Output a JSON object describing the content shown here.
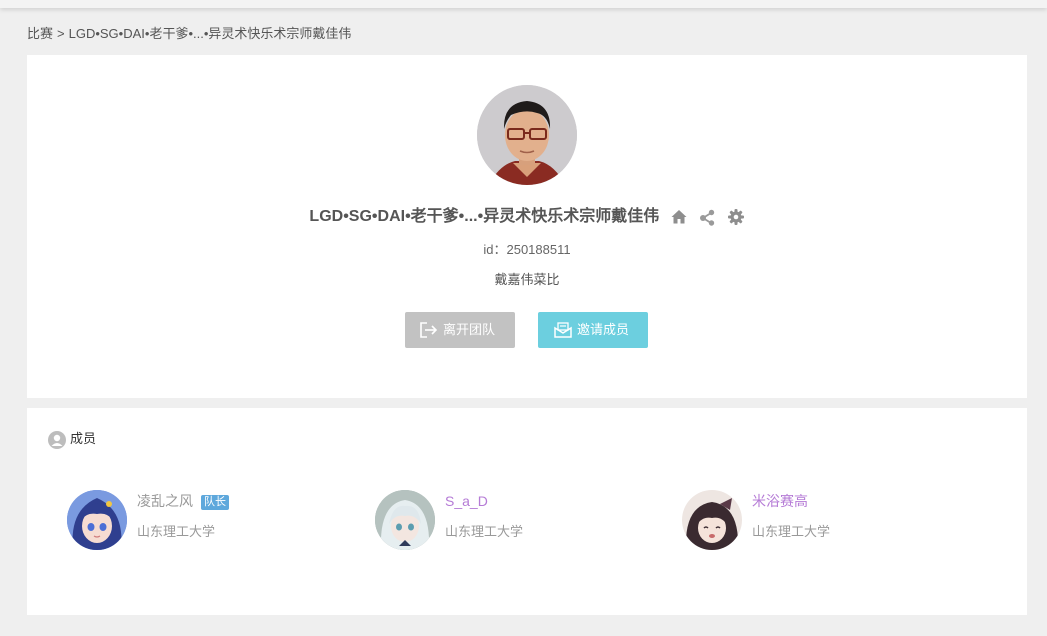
{
  "breadcrumb": {
    "root": "比赛",
    "separator": ">",
    "current": "LGD•SG•DAI•老干爹•...•异灵术快乐术宗师戴佳伟"
  },
  "team": {
    "name": "LGD•SG•DAI•老干爹•...•异灵术快乐术宗师戴佳伟",
    "id_text": "id：250188511",
    "description": "戴嘉伟菜比",
    "icons": [
      "home-icon",
      "share-icon",
      "gear-icon"
    ]
  },
  "actions": {
    "leave_label": "离开团队",
    "invite_label": "邀请成员"
  },
  "members": {
    "title": "成员",
    "list": [
      {
        "name": "凌乱之风",
        "school": "山东理工大学",
        "badge": "队长",
        "name_color": "#999999"
      },
      {
        "name": "S_a_D",
        "school": "山东理工大学",
        "badge": "",
        "name_color": "#b57bd6"
      },
      {
        "name": "米浴赛高",
        "school": "山东理工大学",
        "badge": "",
        "name_color": "#b57bd6"
      }
    ]
  },
  "colors": {
    "leave_button": "#c2c2c2",
    "invite_button": "#6ccfdf",
    "badge": "#5ea8dc"
  }
}
